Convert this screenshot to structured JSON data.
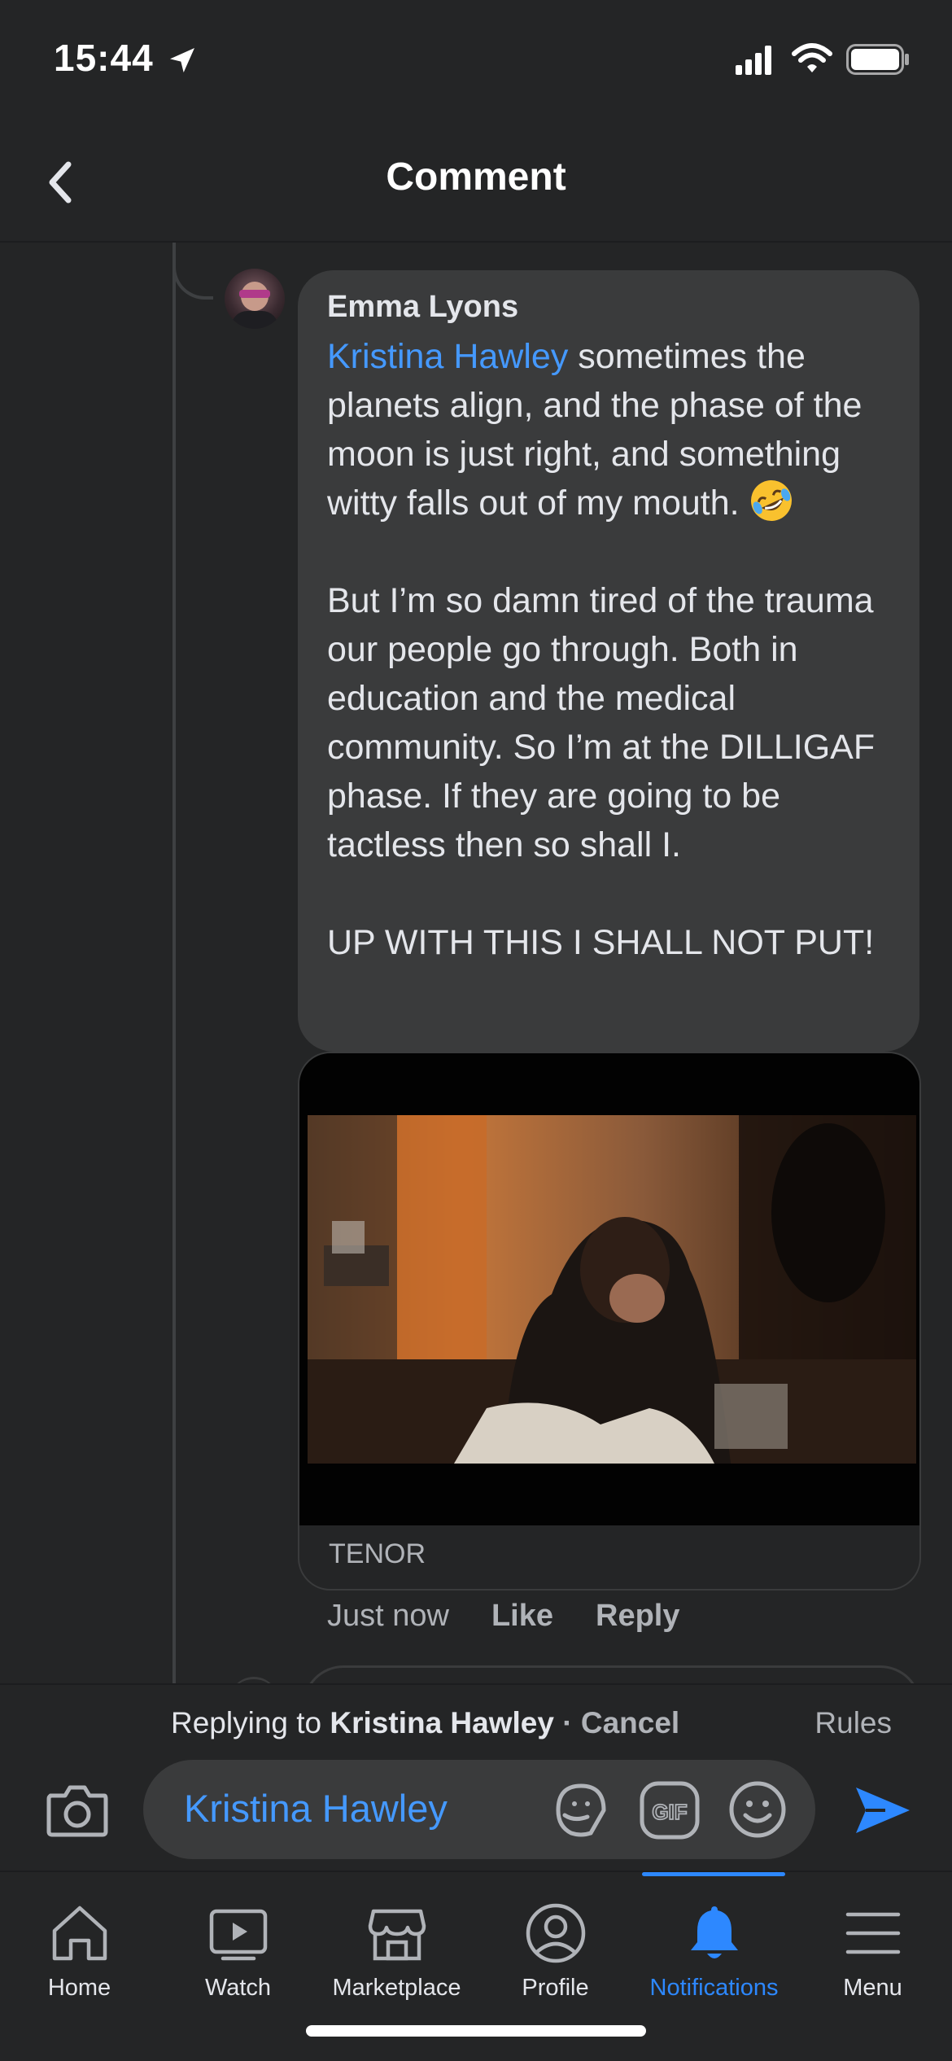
{
  "status_bar": {
    "time": "15:44"
  },
  "header": {
    "title": "Comment"
  },
  "comment": {
    "author": "Emma Lyons",
    "mention": "Kristina Hawley",
    "text_part1": " sometimes the planets align, and the phase of the moon is just right, and something witty falls out of my mouth. ",
    "emoji": "rolling-on-floor-laughing-emoji",
    "paragraph2": "But I’m so damn tired of the trauma our people go through. Both in education and the medical community. So I’m at the DILLIGAF phase. If they are going to be tactless then so shall I.",
    "paragraph3": "UP WITH THIS I SHALL NOT PUT!",
    "gif_source": "TENOR",
    "timestamp": "Just now",
    "like_label": "Like",
    "reply_label": "Reply"
  },
  "composer": {
    "replying_prefix": "Replying to ",
    "replying_name": "Kristina Hawley",
    "separator": " · ",
    "cancel_label": "Cancel",
    "rules_label": "Rules",
    "input_value": "Kristina Hawley",
    "gif_label": "GIF"
  },
  "tabs": [
    {
      "label": "Home",
      "icon": "home-icon"
    },
    {
      "label": "Watch",
      "icon": "watch-icon"
    },
    {
      "label": "Marketplace",
      "icon": "marketplace-icon"
    },
    {
      "label": "Profile",
      "icon": "profile-icon"
    },
    {
      "label": "Notifications",
      "icon": "bell-icon",
      "active": true
    },
    {
      "label": "Menu",
      "icon": "menu-icon"
    }
  ],
  "colors": {
    "background": "#242526",
    "bubble": "#3a3b3c",
    "link": "#4599ff",
    "accent": "#2d88ff"
  }
}
